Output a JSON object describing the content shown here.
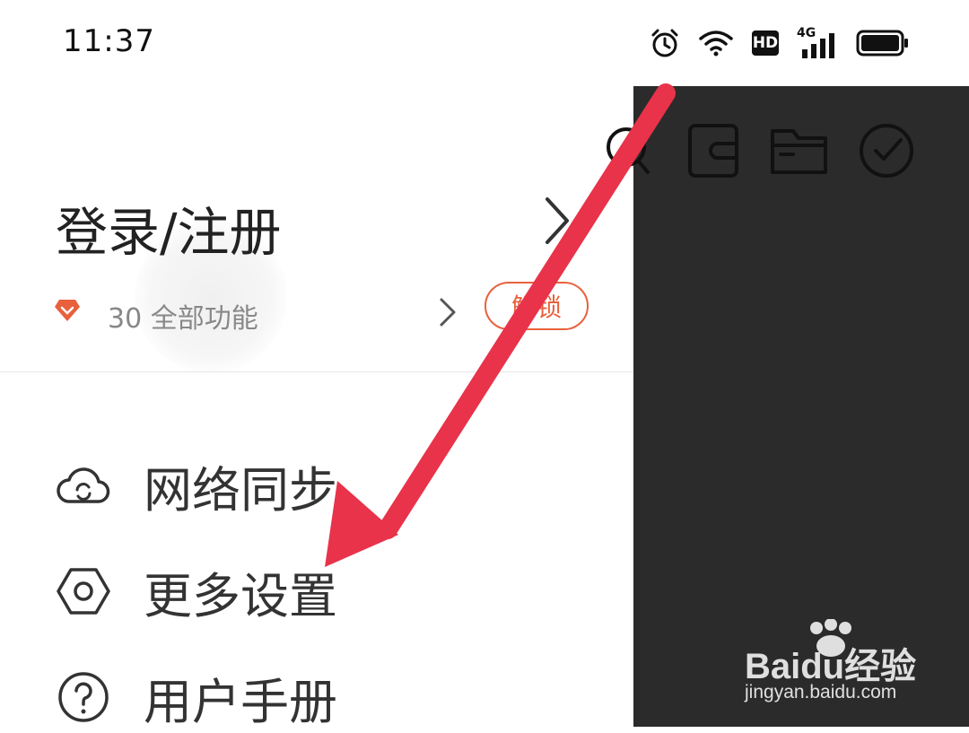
{
  "status_bar": {
    "time": "11:37",
    "icons": [
      "alarm-icon",
      "wifi-icon",
      "hd-icon",
      "signal-4g-icon",
      "battery-icon"
    ],
    "hd_label": "HD",
    "network_label": "4G"
  },
  "drawer": {
    "login_title": "登录/注册",
    "vip_text": "30  全部功能",
    "unlock_label": "解锁",
    "menu": [
      {
        "label": "网络同步",
        "icon": "cloud-sync-icon"
      },
      {
        "label": "更多设置",
        "icon": "settings-hex-icon"
      },
      {
        "label": "用户手册",
        "icon": "help-icon"
      }
    ]
  },
  "background_toolbar": {
    "icons": [
      "search-icon",
      "wallet-icon",
      "folder-icon",
      "check-circle-icon"
    ]
  },
  "watermark": {
    "brand": "Baidu经验",
    "url": "jingyan.baidu.com"
  },
  "colors": {
    "accent": "#e8613c",
    "overlay": "#2b2b2b",
    "annotation_arrow": "#e8334a"
  }
}
